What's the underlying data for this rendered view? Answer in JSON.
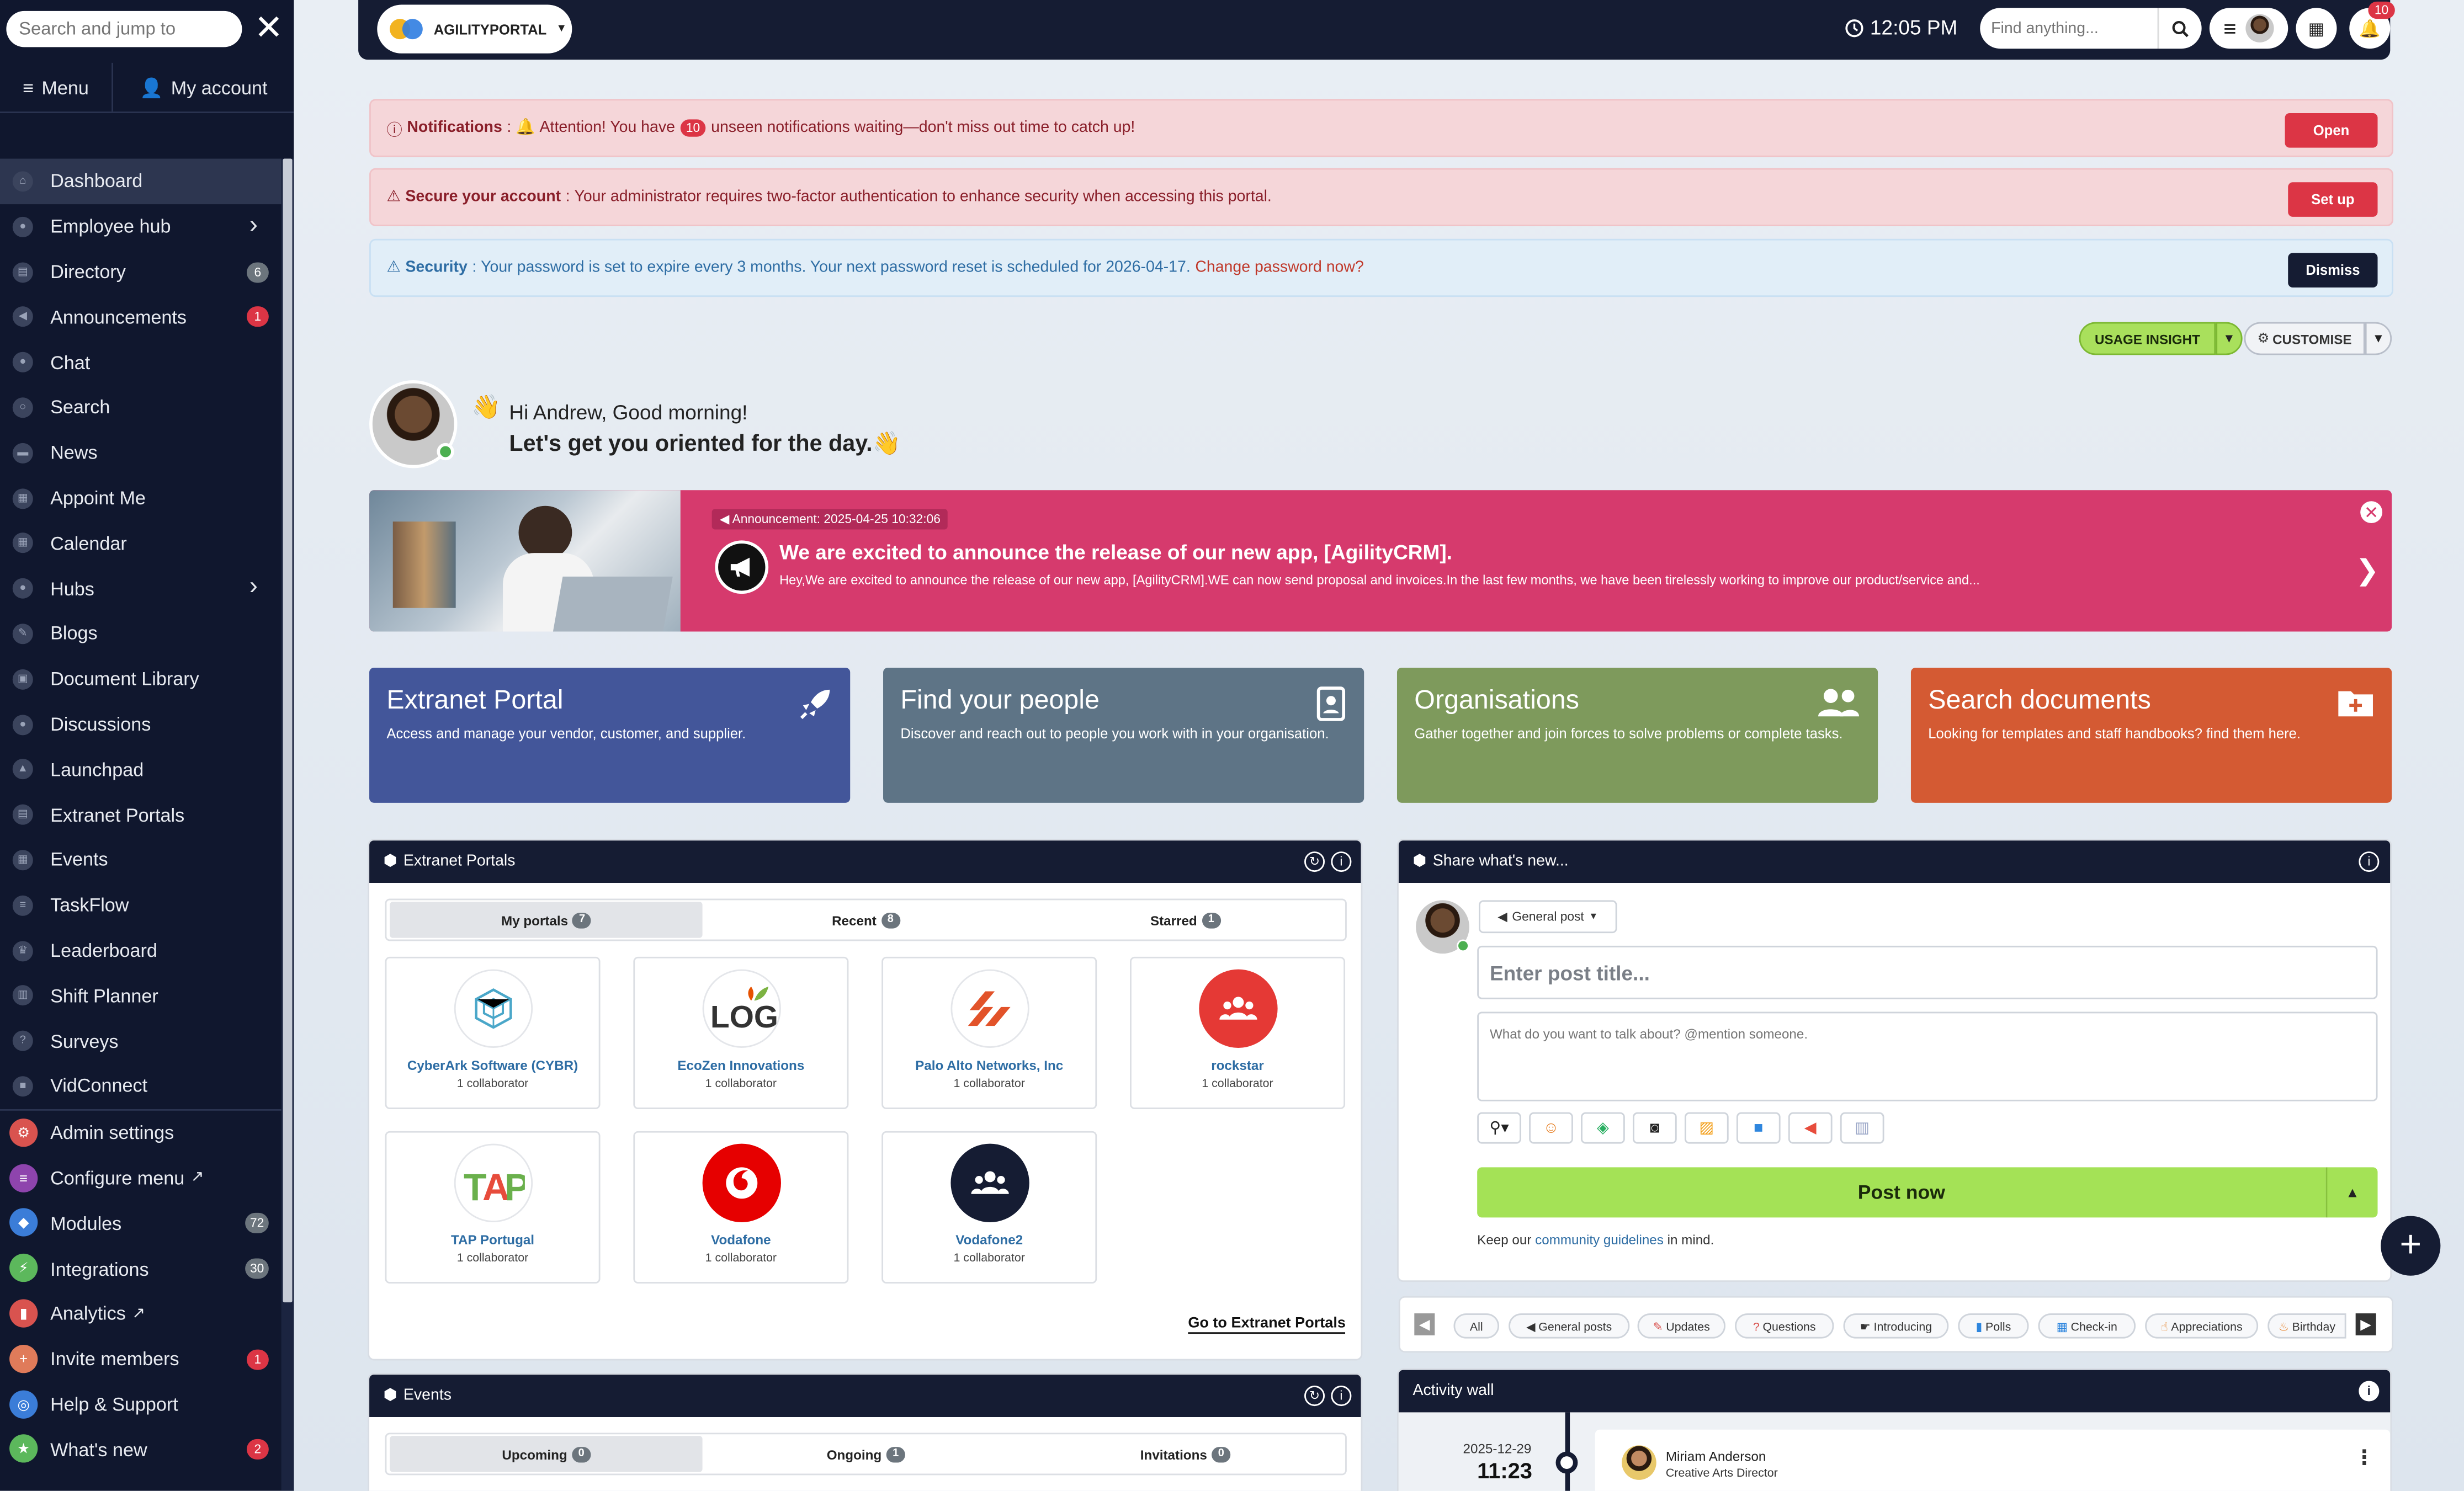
{
  "sidebar": {
    "search_placeholder": "Search and jump to",
    "menu_tab": "Menu",
    "account_tab": "My account",
    "items": [
      {
        "label": "Dashboard"
      },
      {
        "label": "Employee hub"
      },
      {
        "label": "Directory",
        "badge": "6"
      },
      {
        "label": "Announcements",
        "badge": "1"
      },
      {
        "label": "Chat"
      },
      {
        "label": "Search"
      },
      {
        "label": "News"
      },
      {
        "label": "Appoint Me"
      },
      {
        "label": "Calendar"
      },
      {
        "label": "Hubs"
      },
      {
        "label": "Blogs"
      },
      {
        "label": "Document Library"
      },
      {
        "label": "Discussions"
      },
      {
        "label": "Launchpad"
      },
      {
        "label": "Extranet Portals"
      },
      {
        "label": "Events"
      },
      {
        "label": "TaskFlow"
      },
      {
        "label": "Leaderboard"
      },
      {
        "label": "Shift Planner"
      },
      {
        "label": "Surveys"
      },
      {
        "label": "VidConnect"
      }
    ],
    "admin_items": [
      {
        "label": "Admin settings",
        "color": "#d9534f"
      },
      {
        "label": "Configure menu",
        "color": "#8e44ad"
      },
      {
        "label": "Modules",
        "badge": "72",
        "color": "#3b7dd8"
      },
      {
        "label": "Integrations",
        "badge": "30",
        "color": "#5cb85c"
      },
      {
        "label": "Analytics",
        "color": "#d9534f"
      },
      {
        "label": "Invite members",
        "badge": "1",
        "color": "#e07b5a"
      },
      {
        "label": "Help & Support",
        "color": "#3b7dd8"
      },
      {
        "label": "What's new",
        "badge": "2",
        "color": "#5cb85c"
      }
    ]
  },
  "topbar": {
    "brand": "AGILITYPORTAL",
    "time": "12:05 PM",
    "search_placeholder": "Find anything...",
    "notif_count": "10"
  },
  "alerts": {
    "notif": {
      "label": "Notifications",
      "pre": "Attention! You have",
      "count": "10",
      "post": "unseen notifications waiting—don't miss out time to catch up!",
      "button": "Open"
    },
    "secure": {
      "label": "Secure your account",
      "text": "Your administrator requires two-factor authentication to enhance security when accessing this portal.",
      "button": "Set up"
    },
    "security": {
      "label": "Security",
      "text": "Your password is set to expire every 3 months. Your next password reset is scheduled for 2026-04-17.",
      "link": "Change password now?",
      "button": "Dismiss"
    }
  },
  "toolbar": {
    "usage": "USAGE INSIGHT",
    "customise": "CUSTOMISE"
  },
  "greeting": {
    "line1": "Hi Andrew, Good morning!",
    "line2": "Let's get you oriented for the day."
  },
  "announcement": {
    "tag": "Announcement: 2025-04-25 10:32:06",
    "title": "We are excited to announce the release of our new app, [AgilityCRM].",
    "body": "Hey,We are excited to announce the release of our new app, [AgilityCRM].WE can now send proposal and invoices.In the last few months, we have been tirelessly working to improve our product/service and..."
  },
  "tiles": [
    {
      "title": "Extranet Portal",
      "desc": "Access and manage your vendor, customer, and supplier.",
      "color": "#43569a"
    },
    {
      "title": "Find your people",
      "desc": "Discover and reach out to people you work with in your organisation.",
      "color": "#5e7486"
    },
    {
      "title": "Organisations",
      "desc": "Gather together and join forces to solve problems or complete tasks.",
      "color": "#7e9a5c"
    },
    {
      "title": "Search documents",
      "desc": "Looking for templates and staff handbooks? find them here.",
      "color": "#d45a33"
    }
  ],
  "extranet": {
    "title": "Extranet Portals",
    "tabs": [
      {
        "label": "My portals",
        "count": "7"
      },
      {
        "label": "Recent",
        "count": "8"
      },
      {
        "label": "Starred",
        "count": "1"
      }
    ],
    "portals": [
      {
        "name": "CyberArk Software (CYBR)",
        "collab": "1 collaborator"
      },
      {
        "name": "EcoZen Innovations",
        "collab": "1 collaborator"
      },
      {
        "name": "Palo Alto Networks, Inc",
        "collab": "1 collaborator"
      },
      {
        "name": "rockstar",
        "collab": "1 collaborator"
      },
      {
        "name": "TAP Portugal",
        "collab": "1 collaborator"
      },
      {
        "name": "Vodafone",
        "collab": "1 collaborator"
      },
      {
        "name": "Vodafone2",
        "collab": "1 collaborator"
      }
    ],
    "goto": "Go to Extranet Portals"
  },
  "events": {
    "title": "Events",
    "tabs": [
      {
        "label": "Upcoming",
        "count": "0"
      },
      {
        "label": "Ongoing",
        "count": "1"
      },
      {
        "label": "Invitations",
        "count": "0"
      }
    ]
  },
  "share": {
    "title": "Share what's new...",
    "post_type": "General post",
    "title_placeholder": "Enter post title...",
    "body_placeholder": "What do you want to talk about? @mention someone.",
    "post_button": "Post now",
    "guide_pre": "Keep our",
    "guide_link": "community guidelines",
    "guide_post": "in mind."
  },
  "filters": [
    "All",
    "General posts",
    "Updates",
    "Questions",
    "Introducing",
    "Polls",
    "Check-in",
    "Appreciations",
    "Birthday"
  ],
  "activity": {
    "title": "Activity wall",
    "date": "2025-12-29",
    "time": "11:23",
    "name": "Miriam Anderson",
    "role": "Creative Arts Director"
  }
}
